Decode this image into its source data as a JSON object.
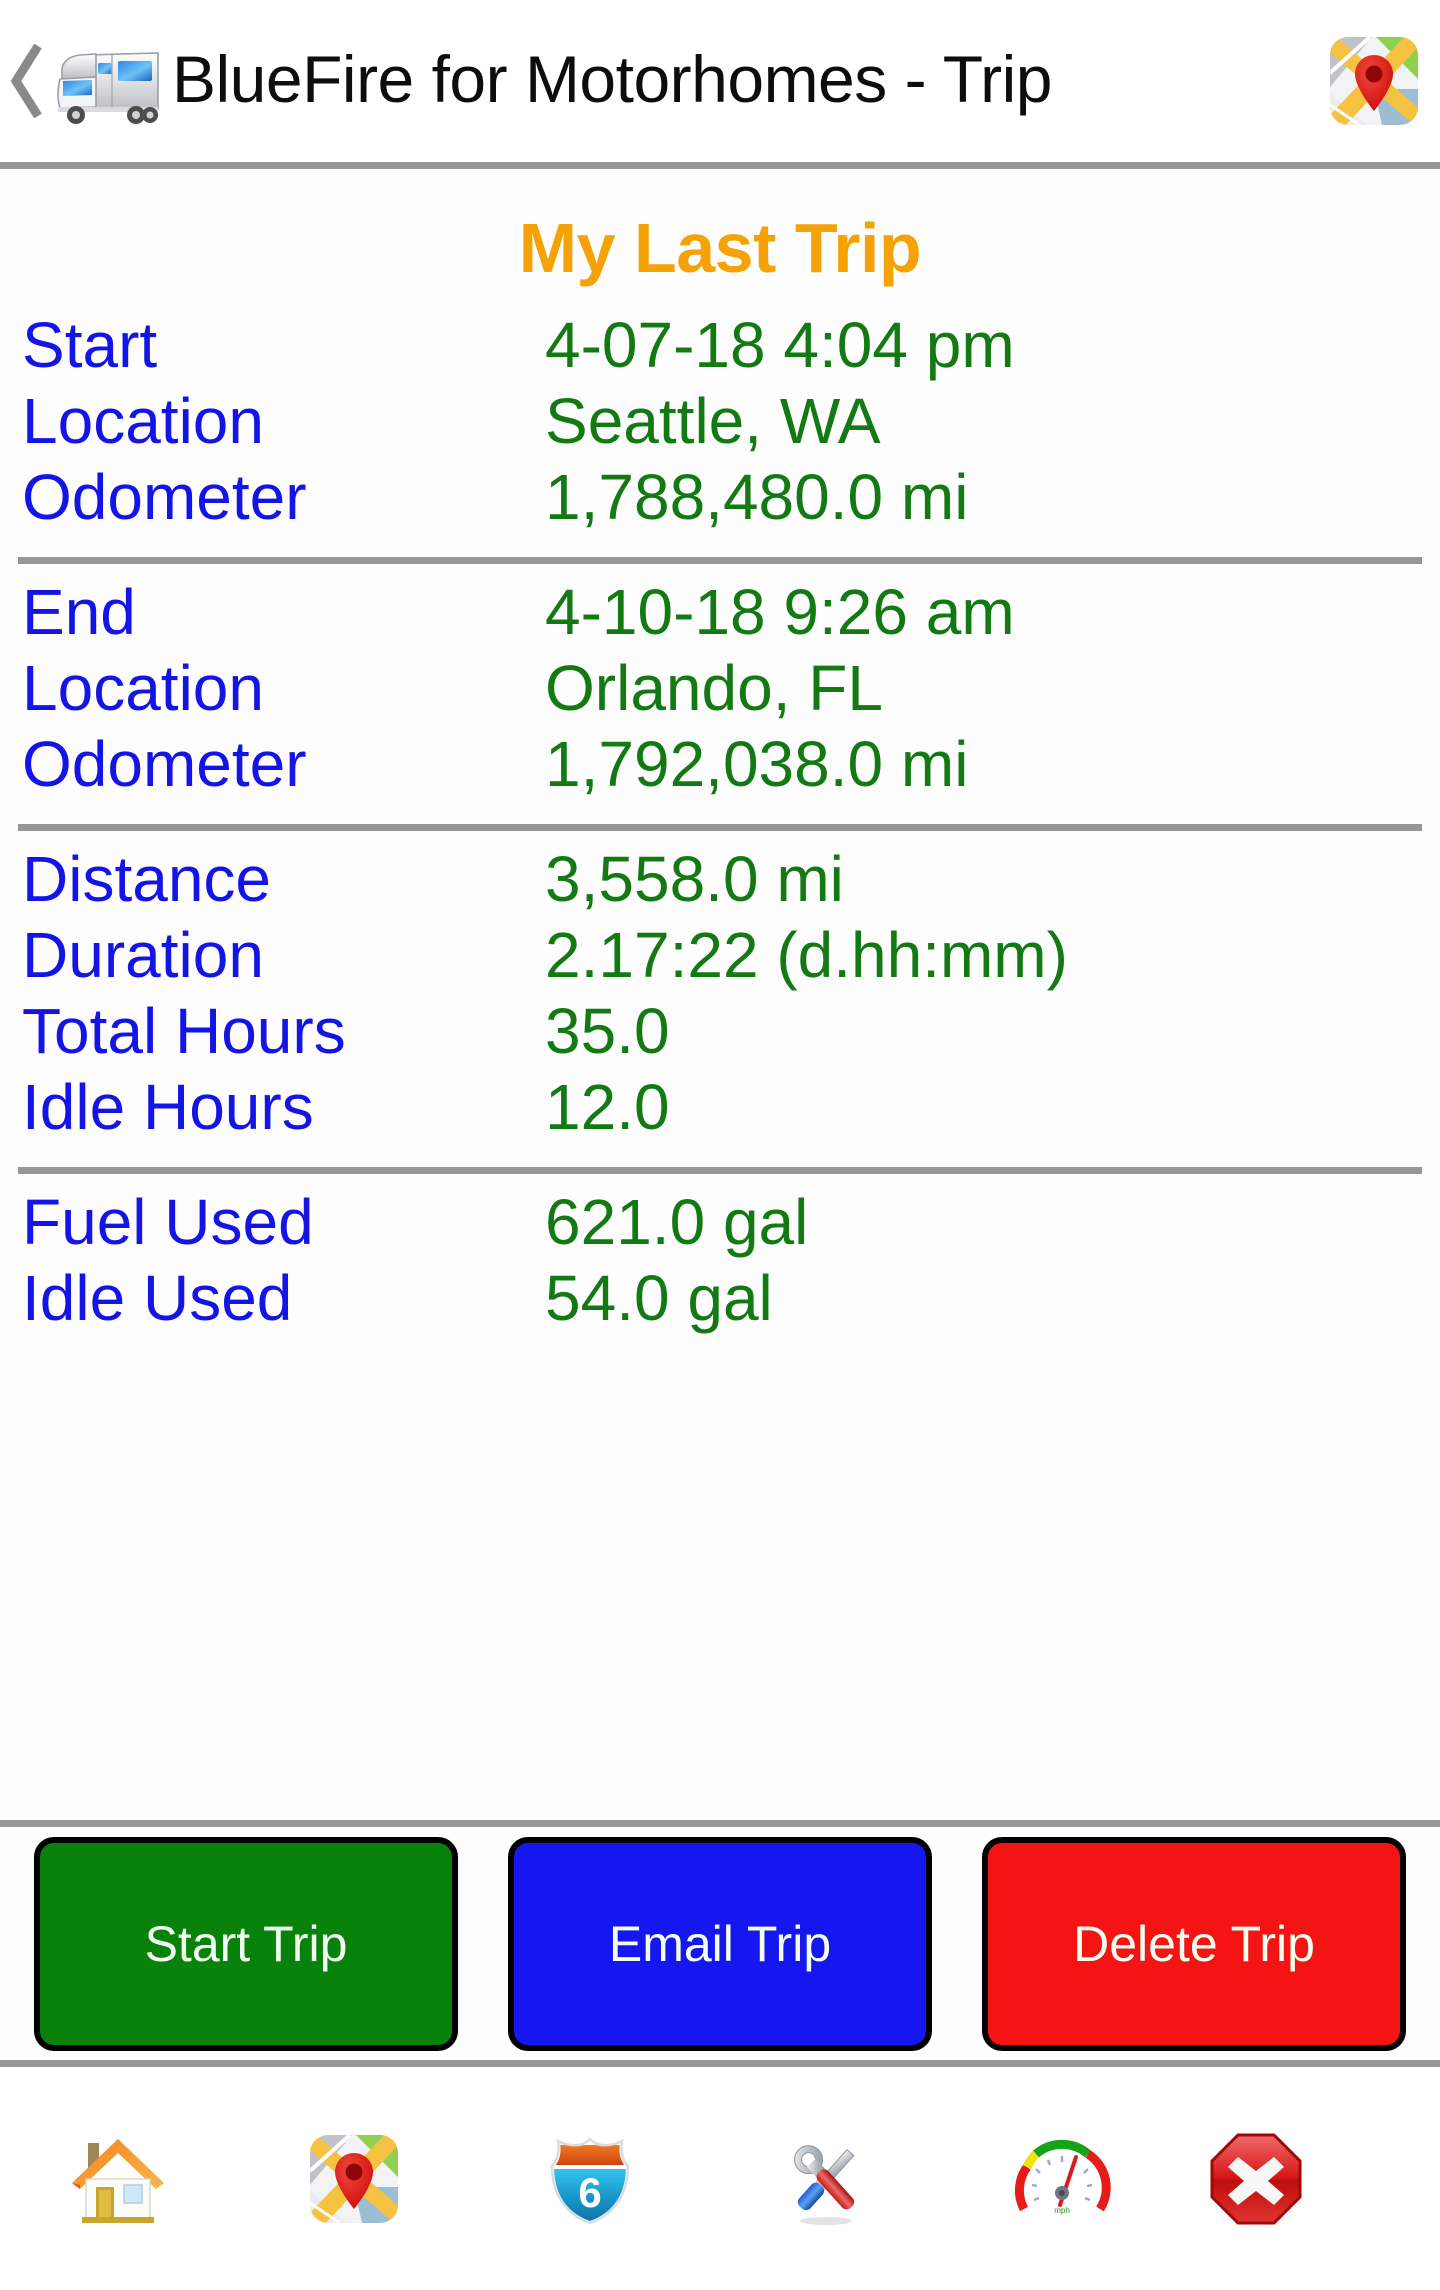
{
  "header": {
    "back_icon": "back-chevron-icon",
    "app_icon": "motorhome-icon",
    "title": "BlueFire for Motorhomes - Trip",
    "action_icon": "maps-icon"
  },
  "content": {
    "page_title": "My Last Trip",
    "groups": [
      {
        "rows": [
          {
            "label": "Start",
            "value": "4-07-18 4:04 pm"
          },
          {
            "label": "Location",
            "value": "Seattle, WA"
          },
          {
            "label": "Odometer",
            "value": "1,788,480.0 mi"
          }
        ]
      },
      {
        "rows": [
          {
            "label": "End",
            "value": "4-10-18 9:26 am"
          },
          {
            "label": "Location",
            "value": "Orlando, FL"
          },
          {
            "label": "Odometer",
            "value": "1,792,038.0 mi"
          }
        ]
      },
      {
        "rows": [
          {
            "label": "Distance",
            "value": "3,558.0 mi"
          },
          {
            "label": "Duration",
            "value": "2.17:22 (d.hh:mm)"
          },
          {
            "label": "Total Hours",
            "value": "35.0"
          },
          {
            "label": "Idle Hours",
            "value": "12.0"
          }
        ]
      },
      {
        "rows": [
          {
            "label": "Fuel Used",
            "value": "621.0 gal"
          },
          {
            "label": "Idle Used",
            "value": "54.0 gal"
          }
        ]
      }
    ]
  },
  "buttons": {
    "start": "Start Trip",
    "email": "Email Trip",
    "delete": "Delete Trip"
  },
  "bottom_nav": [
    {
      "icon": "home-icon"
    },
    {
      "icon": "maps-icon"
    },
    {
      "icon": "highway-shield-icon",
      "badge": "6"
    },
    {
      "icon": "tools-icon"
    },
    {
      "icon": "gauge-icon"
    },
    {
      "icon": "exit-stop-icon"
    }
  ],
  "colors": {
    "title_orange": "#F5A207",
    "label_blue": "#1414E6",
    "value_green": "#137A13",
    "separator_gray": "#969696",
    "start_green": "#08820A",
    "email_blue": "#1616F0",
    "delete_red": "#F41414"
  }
}
